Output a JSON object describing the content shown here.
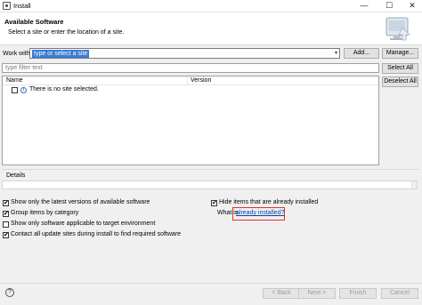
{
  "window": {
    "title": "Install",
    "controls": {
      "minimize": "—",
      "maximize": "☐",
      "close": "✕"
    }
  },
  "header": {
    "title": "Available Software",
    "subtitle": "Select a site or enter the location of a site."
  },
  "work_with": {
    "label": "Work with:",
    "value": "type or select a site",
    "add_label": "Add...",
    "manage_label": "Manage..."
  },
  "filter": {
    "placeholder": "type filter text"
  },
  "buttons": {
    "select_all": "Select All",
    "deselect_all": "Deselect All"
  },
  "tree": {
    "columns": [
      "Name",
      "Version"
    ],
    "rows": [
      {
        "name": "There is no site selected.",
        "checked": false
      }
    ]
  },
  "details": {
    "label": "Details"
  },
  "options": {
    "latest": {
      "label": "Show only the latest versions of available software",
      "checked": true
    },
    "group": {
      "label": "Group items by category",
      "checked": true
    },
    "applicable": {
      "label": "Show only software applicable to target environment",
      "checked": false
    },
    "contact": {
      "label": "Contact all update sites during install to find required software",
      "checked": true
    },
    "hide": {
      "label": "Hide items that are already installed",
      "checked": true
    }
  },
  "whatis": {
    "prefix": "What is",
    "link": "already installed",
    "suffix": "?"
  },
  "footer": {
    "help": "?",
    "back": "< Back",
    "next": "Next >",
    "finish": "Finish",
    "cancel": "Cancel"
  },
  "colors": {
    "selection": "#3a7bd5",
    "link": "#0645ad",
    "highlight_box": "#e0322f"
  }
}
